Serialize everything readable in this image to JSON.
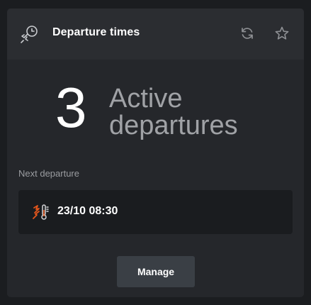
{
  "header": {
    "title": "Departure times",
    "icon": "rocket-clock-icon",
    "refresh_icon": "refresh-icon",
    "favorite_icon": "star-icon"
  },
  "summary": {
    "count": "3",
    "label_line1": "Active",
    "label_line2": "departures"
  },
  "next_departure": {
    "section_label": "Next departure",
    "datetime": "23/10 08:30",
    "icon": "heating-thermometer-icon",
    "icon_color": "#e4561c"
  },
  "actions": {
    "manage_label": "Manage"
  }
}
